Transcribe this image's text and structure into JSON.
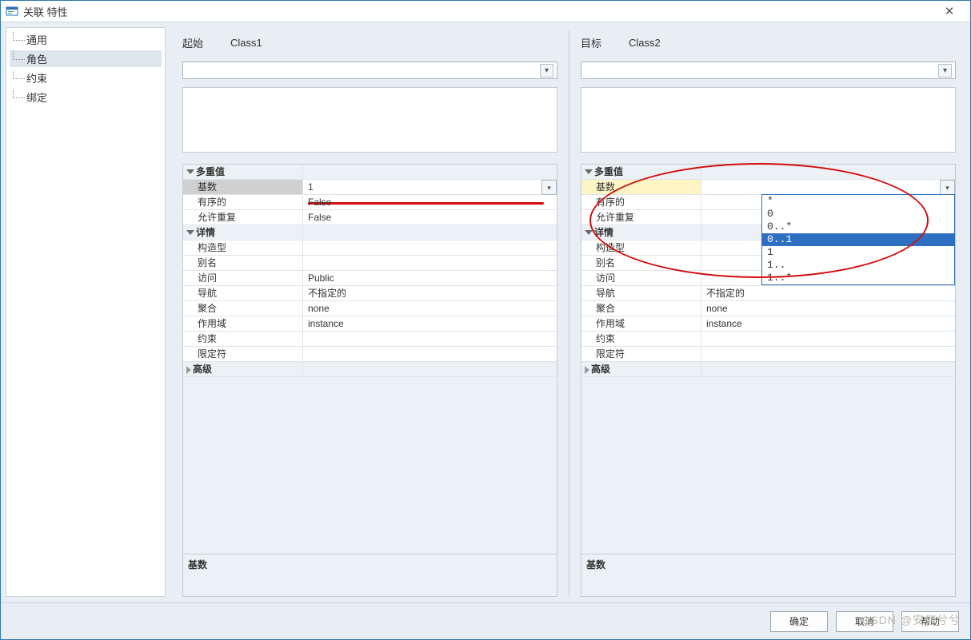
{
  "window": {
    "title": "关联 特性"
  },
  "sidebar": {
    "items": [
      {
        "label": "通用"
      },
      {
        "label": "角色",
        "selected": true
      },
      {
        "label": "约束"
      },
      {
        "label": "绑定"
      }
    ]
  },
  "source_panel": {
    "header_label": "起始",
    "header_class": "Class1",
    "groups": {
      "multiplicity": {
        "title": "多重值",
        "cardinality": {
          "label": "基数",
          "value": "1",
          "selected": true
        },
        "ordered": {
          "label": "有序的",
          "value": "False"
        },
        "allow_dup": {
          "label": "允许重复",
          "value": "False"
        }
      },
      "detail": {
        "title": "详情",
        "stereotype": {
          "label": "构造型",
          "value": ""
        },
        "alias": {
          "label": "别名",
          "value": ""
        },
        "access": {
          "label": "访问",
          "value": "Public"
        },
        "navigation": {
          "label": "导航",
          "value": "不指定的"
        },
        "aggregation": {
          "label": "聚合",
          "value": "none"
        },
        "scope": {
          "label": "作用域",
          "value": "instance"
        },
        "constraint": {
          "label": "约束",
          "value": ""
        },
        "qualifier": {
          "label": "限定符",
          "value": ""
        }
      },
      "advanced": {
        "title": "高级"
      }
    },
    "footer_label": "基数"
  },
  "target_panel": {
    "header_label": "目标",
    "header_class": "Class2",
    "groups": {
      "multiplicity": {
        "title": "多重值",
        "cardinality": {
          "label": "基数",
          "value": "",
          "selected": true,
          "dropdown_open": true
        },
        "ordered": {
          "label": "有序的",
          "value": ""
        },
        "allow_dup": {
          "label": "允许重复",
          "value": ""
        }
      },
      "detail": {
        "title": "详情",
        "stereotype": {
          "label": "构造型",
          "value": ""
        },
        "alias": {
          "label": "别名",
          "value": ""
        },
        "access": {
          "label": "访问",
          "value": ""
        },
        "navigation": {
          "label": "导航",
          "value": "不指定的"
        },
        "aggregation": {
          "label": "聚合",
          "value": "none"
        },
        "scope": {
          "label": "作用域",
          "value": "instance"
        },
        "constraint": {
          "label": "约束",
          "value": ""
        },
        "qualifier": {
          "label": "限定符",
          "value": ""
        }
      },
      "advanced": {
        "title": "高级"
      }
    },
    "dropdown_options": [
      "*",
      "0",
      "0..*",
      "0..1",
      "1",
      "1..",
      "1..*"
    ],
    "dropdown_selected_index": 3,
    "footer_label": "基数"
  },
  "buttons": {
    "ok": "确定",
    "cancel": "取消",
    "help": "帮助"
  },
  "watermark": "CSDN @安何兮兮"
}
